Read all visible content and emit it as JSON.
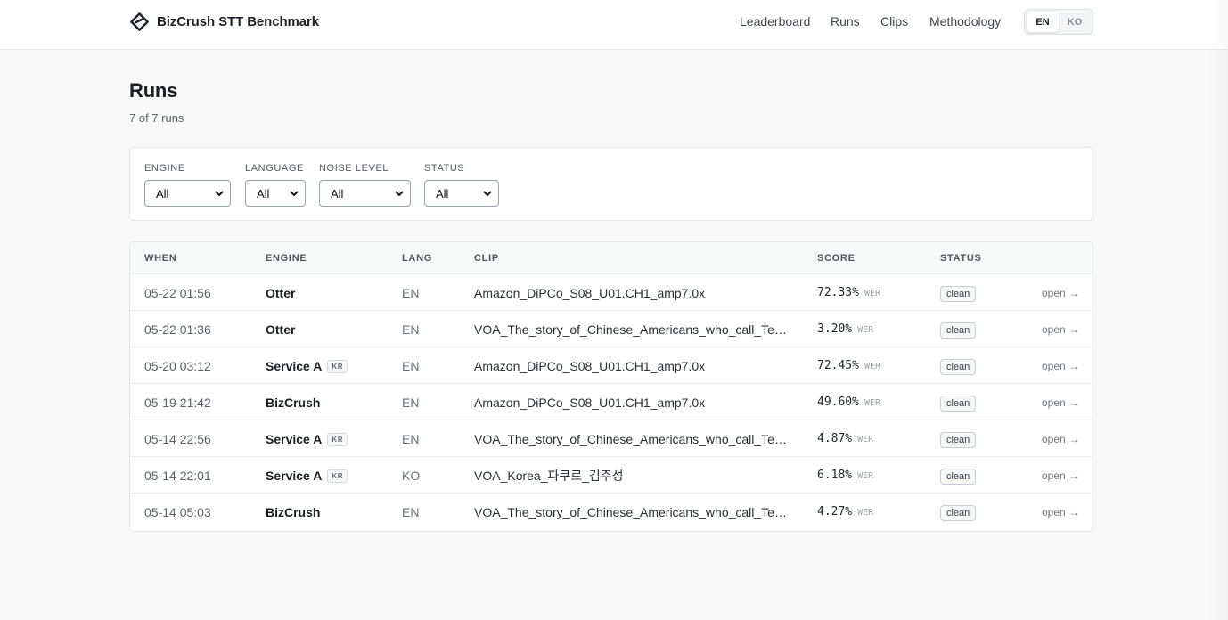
{
  "header": {
    "brand": "BizCrush STT Benchmark",
    "nav": [
      "Leaderboard",
      "Runs",
      "Clips",
      "Methodology"
    ],
    "lang_options": [
      "EN",
      "KO"
    ],
    "active_lang": "EN"
  },
  "page": {
    "title": "Runs",
    "subtitle": "7 of 7 runs"
  },
  "filters": [
    {
      "label": "ENGINE",
      "value": "All"
    },
    {
      "label": "LANGUAGE",
      "value": "All"
    },
    {
      "label": "NOISE LEVEL",
      "value": "All"
    },
    {
      "label": "STATUS",
      "value": "All"
    }
  ],
  "table": {
    "columns": [
      "WHEN",
      "ENGINE",
      "LANG",
      "CLIP",
      "SCORE",
      "STATUS"
    ],
    "unit": "WER",
    "open_label": "open →",
    "rows": [
      {
        "when": "05-22 01:56",
        "engine": "Otter",
        "tag": "",
        "lang": "EN",
        "clip": "Amazon_DiPCo_S08_U01.CH1_amp7.0x",
        "score": "72.33%",
        "status": "clean"
      },
      {
        "when": "05-22 01:36",
        "engine": "Otter",
        "tag": "",
        "lang": "EN",
        "clip": "VOA_The_story_of_Chinese_Americans_who_call_Tex…",
        "score": "3.20%",
        "status": "clean"
      },
      {
        "when": "05-20 03:12",
        "engine": "Service A",
        "tag": "KR",
        "lang": "EN",
        "clip": "Amazon_DiPCo_S08_U01.CH1_amp7.0x",
        "score": "72.45%",
        "status": "clean"
      },
      {
        "when": "05-19 21:42",
        "engine": "BizCrush",
        "tag": "",
        "lang": "EN",
        "clip": "Amazon_DiPCo_S08_U01.CH1_amp7.0x",
        "score": "49.60%",
        "status": "clean"
      },
      {
        "when": "05-14 22:56",
        "engine": "Service A",
        "tag": "KR",
        "lang": "EN",
        "clip": "VOA_The_story_of_Chinese_Americans_who_call_Tex…",
        "score": "4.87%",
        "status": "clean"
      },
      {
        "when": "05-14 22:01",
        "engine": "Service A",
        "tag": "KR",
        "lang": "KO",
        "clip": "VOA_Korea_파쿠르_김주성",
        "score": "6.18%",
        "status": "clean"
      },
      {
        "when": "05-14 05:03",
        "engine": "BizCrush",
        "tag": "",
        "lang": "EN",
        "clip": "VOA_The_story_of_Chinese_Americans_who_call_Tex…",
        "score": "4.27%",
        "status": "clean"
      }
    ]
  }
}
